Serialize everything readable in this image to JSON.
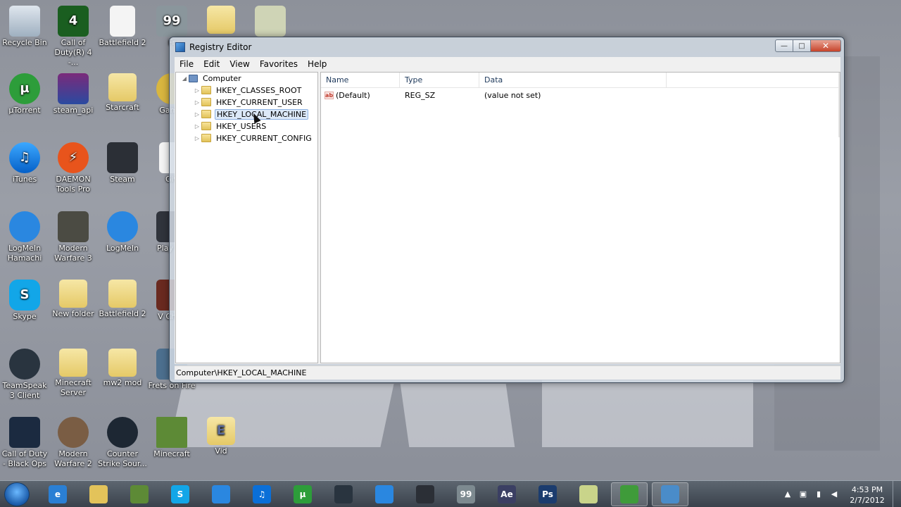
{
  "desktop": {
    "icons": [
      {
        "label": "Recycle Bin",
        "glyph": ""
      },
      {
        "label": "Call of Duty(R) 4 -...",
        "glyph": "4"
      },
      {
        "label": "Battlefield 2",
        "glyph": ""
      },
      {
        "label": "Fr",
        "glyph": "99"
      },
      {
        "label": "",
        "glyph": ""
      },
      {
        "label": "",
        "glyph": ""
      },
      {
        "label": "µTorrent",
        "glyph": "µ"
      },
      {
        "label": "steam_api",
        "glyph": ""
      },
      {
        "label": "Starcraft",
        "glyph": ""
      },
      {
        "label": "Gam L",
        "glyph": ""
      },
      {
        "label": "iTunes",
        "glyph": "♫"
      },
      {
        "label": "DAEMON Tools Pro",
        "glyph": "⚡"
      },
      {
        "label": "Steam",
        "glyph": ""
      },
      {
        "label": "Giv",
        "glyph": ""
      },
      {
        "label": "LogMeIn Hamachi",
        "glyph": ""
      },
      {
        "label": "Modern Warfare 3",
        "glyph": ""
      },
      {
        "label": "LogMeIn",
        "glyph": ""
      },
      {
        "label": "Play Du",
        "glyph": ""
      },
      {
        "label": "Skype",
        "glyph": "S"
      },
      {
        "label": "New folder",
        "glyph": ""
      },
      {
        "label": "Battlefield 2",
        "glyph": ""
      },
      {
        "label": "V Chan",
        "glyph": ""
      },
      {
        "label": "TeamSpeak 3 Client",
        "glyph": ""
      },
      {
        "label": "Minecraft Server",
        "glyph": ""
      },
      {
        "label": "mw2 mod",
        "glyph": ""
      },
      {
        "label": "Frets on Fire",
        "glyph": ""
      },
      {
        "label": "Call of Duty - Black Ops",
        "glyph": ""
      },
      {
        "label": "Modern Warfare 2",
        "glyph": ""
      },
      {
        "label": "Counter Strike Sour...",
        "glyph": ""
      },
      {
        "label": "Minecraft",
        "glyph": ""
      },
      {
        "label": "Vid",
        "glyph": "E"
      }
    ]
  },
  "window": {
    "title": "Registry Editor",
    "controls": {
      "minimize": "—",
      "maximize": "□",
      "close": "✕"
    },
    "menu": [
      "File",
      "Edit",
      "View",
      "Favorites",
      "Help"
    ],
    "tree": {
      "root": "Computer",
      "children": [
        {
          "label": "HKEY_CLASSES_ROOT",
          "selected": false
        },
        {
          "label": "HKEY_CURRENT_USER",
          "selected": false
        },
        {
          "label": "HKEY_LOCAL_MACHINE",
          "selected": true
        },
        {
          "label": "HKEY_USERS",
          "selected": false
        },
        {
          "label": "HKEY_CURRENT_CONFIG",
          "selected": false
        }
      ]
    },
    "list": {
      "columns": [
        "Name",
        "Type",
        "Data"
      ],
      "rows": [
        {
          "icon": "ab",
          "name": "(Default)",
          "type": "REG_SZ",
          "data": "(value not set)"
        }
      ]
    },
    "status": "Computer\\HKEY_LOCAL_MACHINE"
  },
  "taskbar": {
    "buttons": [
      {
        "name": "internet-explorer",
        "glyph": "e",
        "color": "#2a7fd4"
      },
      {
        "name": "windows-explorer",
        "glyph": "",
        "color": "#e3c35a"
      },
      {
        "name": "minecraft",
        "glyph": "",
        "color": "#5d8a36"
      },
      {
        "name": "skype",
        "glyph": "S",
        "color": "#12a6e8"
      },
      {
        "name": "hamachi",
        "glyph": "",
        "color": "#2a87e0"
      },
      {
        "name": "itunes",
        "glyph": "♫",
        "color": "#0a6fd8"
      },
      {
        "name": "utorrent",
        "glyph": "µ",
        "color": "#2d9d3a"
      },
      {
        "name": "teamspeak",
        "glyph": "",
        "color": "#29343f"
      },
      {
        "name": "logmein",
        "glyph": "",
        "color": "#2a87e0"
      },
      {
        "name": "steam",
        "glyph": "",
        "color": "#2b2f36"
      },
      {
        "name": "frets-on-fire",
        "glyph": "99",
        "color": "#7d8a90"
      },
      {
        "name": "after-effects",
        "glyph": "Ae",
        "color": "#3b3f63"
      },
      {
        "name": "photoshop",
        "glyph": "Ps",
        "color": "#1b3c6e"
      },
      {
        "name": "notes",
        "glyph": "",
        "color": "#c9d48a"
      },
      {
        "name": "recorder",
        "glyph": "",
        "color": "#3f9b3a"
      },
      {
        "name": "regedit",
        "glyph": "",
        "color": "#4a8cc9"
      }
    ],
    "clock": {
      "time": "4:53 PM",
      "date": "2/7/2012"
    }
  }
}
